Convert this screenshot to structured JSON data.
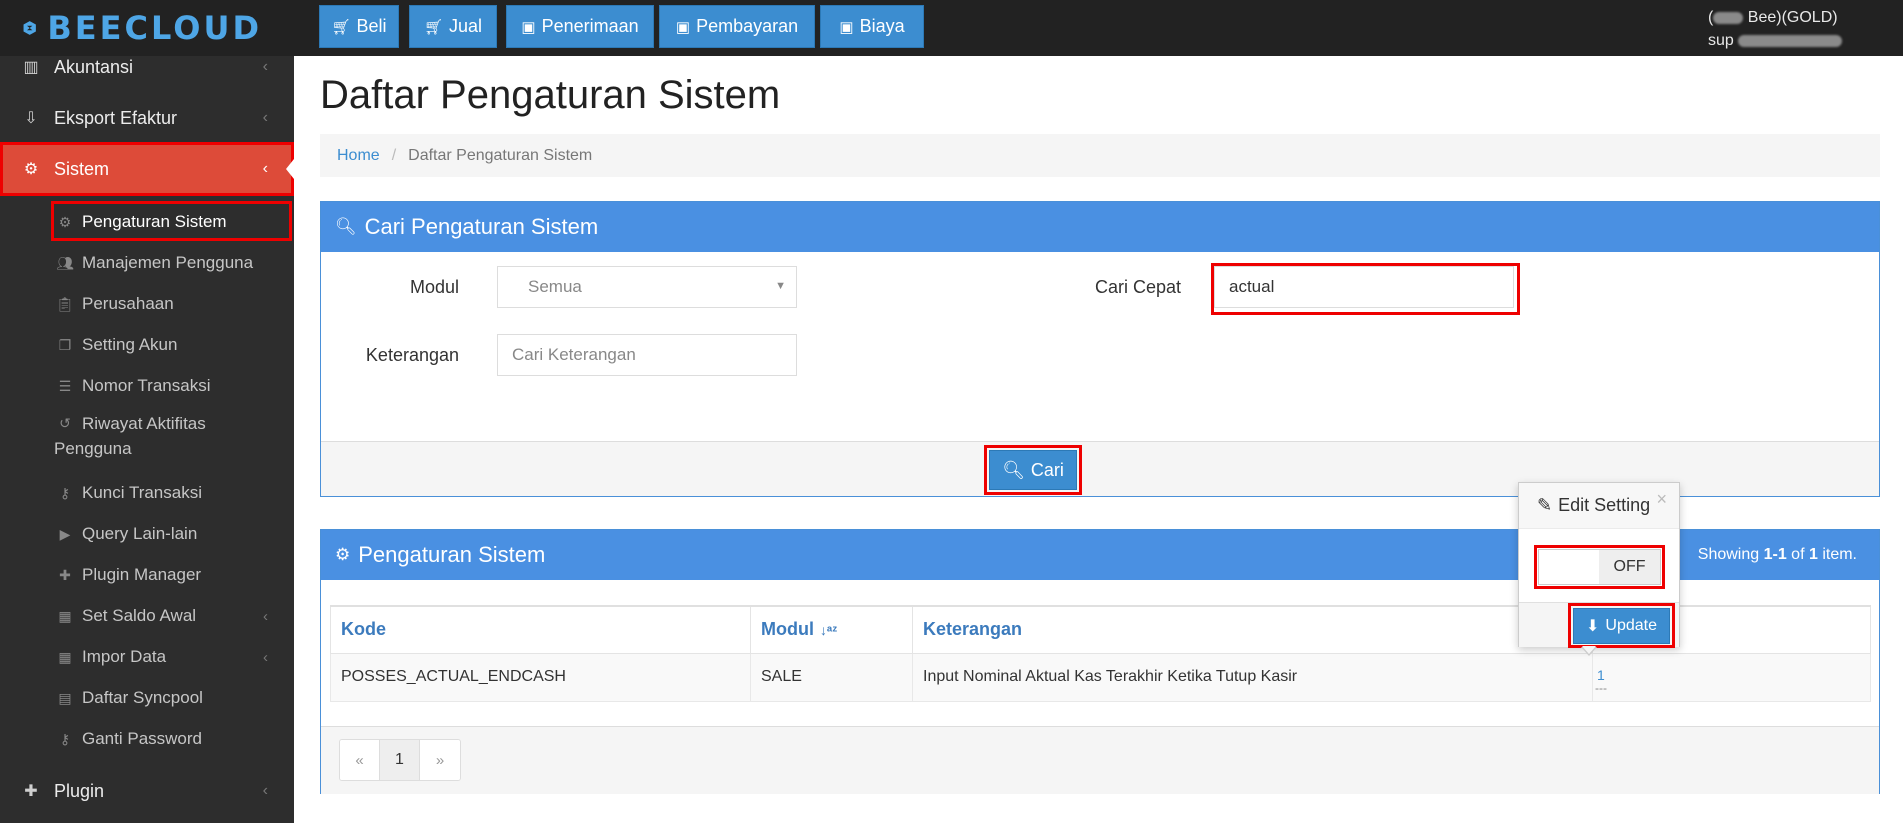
{
  "app": {
    "name": "BEECLOUD"
  },
  "topbar": {
    "buttons": [
      {
        "label": "Beli",
        "icon": "cart-icon"
      },
      {
        "label": "Jual",
        "icon": "cart-icon"
      },
      {
        "label": "Penerimaan",
        "icon": "money-icon"
      },
      {
        "label": "Pembayaran",
        "icon": "money-icon"
      },
      {
        "label": "Biaya",
        "icon": "money-icon"
      }
    ],
    "user": {
      "line1_prefix": "(",
      "line1_suffix": " Bee)(GOLD)",
      "line2_prefix": "sup"
    }
  },
  "sidebar": {
    "items": [
      {
        "label": "Akuntansi",
        "icon": "chart-icon"
      },
      {
        "label": "Eksport Efaktur",
        "icon": "export-icon"
      },
      {
        "label": "Sistem",
        "icon": "cogs-icon",
        "active": true
      },
      {
        "label": "Plugin",
        "icon": "puzzle-icon"
      }
    ],
    "subitems": [
      {
        "label": "Pengaturan Sistem",
        "icon": "gear-icon",
        "current": true
      },
      {
        "label": "Manajemen Pengguna",
        "icon": "users-icon"
      },
      {
        "label": "Perusahaan",
        "icon": "clipboard-icon"
      },
      {
        "label": "Setting Akun",
        "icon": "copy-icon"
      },
      {
        "label": "Nomor Transaksi",
        "icon": "list-icon"
      },
      {
        "label": "Riwayat Aktifitas",
        "label2": "Pengguna",
        "icon": "history-icon"
      },
      {
        "label": "Kunci Transaksi",
        "icon": "key-icon"
      },
      {
        "label": "Query Lain-lain",
        "icon": "play-icon"
      },
      {
        "label": "Plugin Manager",
        "icon": "puzzle-icon"
      },
      {
        "label": "Set Saldo Awal",
        "icon": "calculator-icon",
        "has_children": true
      },
      {
        "label": "Impor Data",
        "icon": "table-icon",
        "has_children": true
      },
      {
        "label": "Daftar Syncpool",
        "icon": "list-alt-icon"
      },
      {
        "label": "Ganti Password",
        "icon": "key-icon"
      }
    ]
  },
  "main": {
    "title": "Daftar Pengaturan Sistem",
    "breadcrumb": {
      "home": "Home",
      "current": "Daftar Pengaturan Sistem"
    },
    "search_panel": {
      "title": "Cari Pengaturan Sistem",
      "modul_label": "Modul",
      "modul_value": "Semua",
      "keterangan_label": "Keterangan",
      "keterangan_placeholder": "Cari Keterangan",
      "cari_cepat_label": "Cari Cepat",
      "cari_cepat_value": "actual",
      "search_button": "Cari"
    },
    "result_panel": {
      "title": "Pengaturan Sistem",
      "showing_prefix": "Showing ",
      "showing_range": "1-1",
      "showing_mid": " of ",
      "showing_total": "1",
      "showing_suffix": " item.",
      "columns": [
        "Kode",
        "Modul",
        "Keterangan",
        ""
      ],
      "rows": [
        {
          "kode": "POSSES_ACTUAL_ENDCASH",
          "modul": "SALE",
          "keterangan": "Input Nominal Aktual Kas Terakhir Ketika Tutup Kasir",
          "value": "1",
          "sub": "---"
        }
      ],
      "pagination": {
        "prev": "«",
        "page": "1",
        "next": "»"
      }
    },
    "popover": {
      "title": "Edit Setting",
      "toggle_state": "OFF",
      "update_button": "Update",
      "close": "×"
    }
  },
  "colors": {
    "accent": "#4a90e2",
    "active": "#dd4b39",
    "highlight": "#e00000",
    "sidebar_bg": "#2d2d2d",
    "topbar_bg": "#222222"
  }
}
